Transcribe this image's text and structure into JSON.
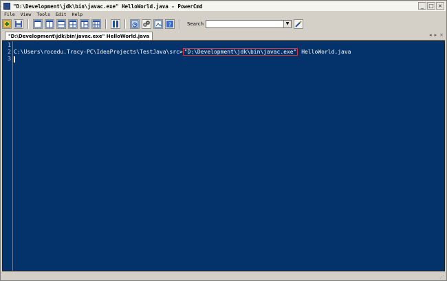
{
  "window": {
    "title": "\"D:\\Development\\jdk\\bin\\javac.exe\"  HelloWorld.java - PowerCmd",
    "buttons": [
      "_",
      "□",
      "×"
    ]
  },
  "menu": [
    "File",
    "View",
    "Tools",
    "Edit",
    "Help"
  ],
  "toolbar": {
    "icons": [
      "new-console-icon",
      "save-icon",
      "layout-single-icon",
      "layout-split-vertical-icon",
      "layout-split-horizontal-icon",
      "layout-quad-icon",
      "layout-three-icon",
      "layout-grid-icon",
      "columns-icon",
      "history-icon",
      "settings-icon",
      "screenshot-icon",
      "help-icon",
      "clear-search-icon"
    ],
    "search_label": "Search",
    "search_value": ""
  },
  "tab": {
    "label": "\"D:\\Development\\jdk\\bin\\javac.exe\"  HelloWorld.java",
    "controls": [
      "◂",
      "▸",
      "×"
    ]
  },
  "editor": {
    "line_numbers": [
      "1",
      "2",
      "3"
    ],
    "line2_prefix": "C:\\Users\\rocedu.Tracy-PC\\IdeaProjects\\TestJava\\src>",
    "line2_highlight": "\"D:\\Development\\jdk\\bin\\javac.exe\"",
    "line2_suffix": " HelloWorld.java",
    "background": "#04326a",
    "highlight_color": "#e0343a"
  }
}
